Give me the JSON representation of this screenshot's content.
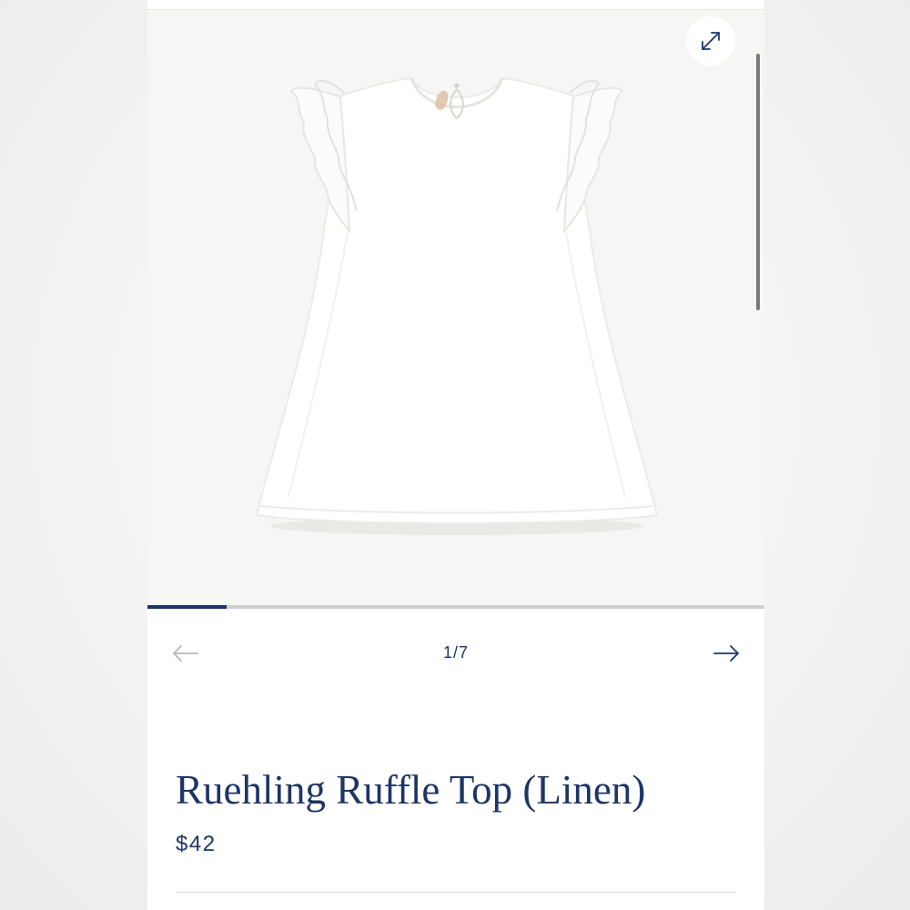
{
  "product": {
    "title": "Ruehling Ruffle Top (Linen)",
    "price": "$42",
    "image_alt": "White linen sleeveless top with ruffle shoulders"
  },
  "gallery": {
    "counter": "1/7",
    "current_index": 1,
    "total_images": 7,
    "progress_fraction": 0.1286,
    "expand_icon": "expand-arrows-icon",
    "prev_icon": "arrow-left-icon",
    "next_icon": "arrow-right-icon"
  },
  "colors": {
    "brand_navy": "#1e3564",
    "image_background": "#f6f6f4",
    "progress_track": "#cfcfcf",
    "disabled_arrow": "#b5b9c3"
  }
}
